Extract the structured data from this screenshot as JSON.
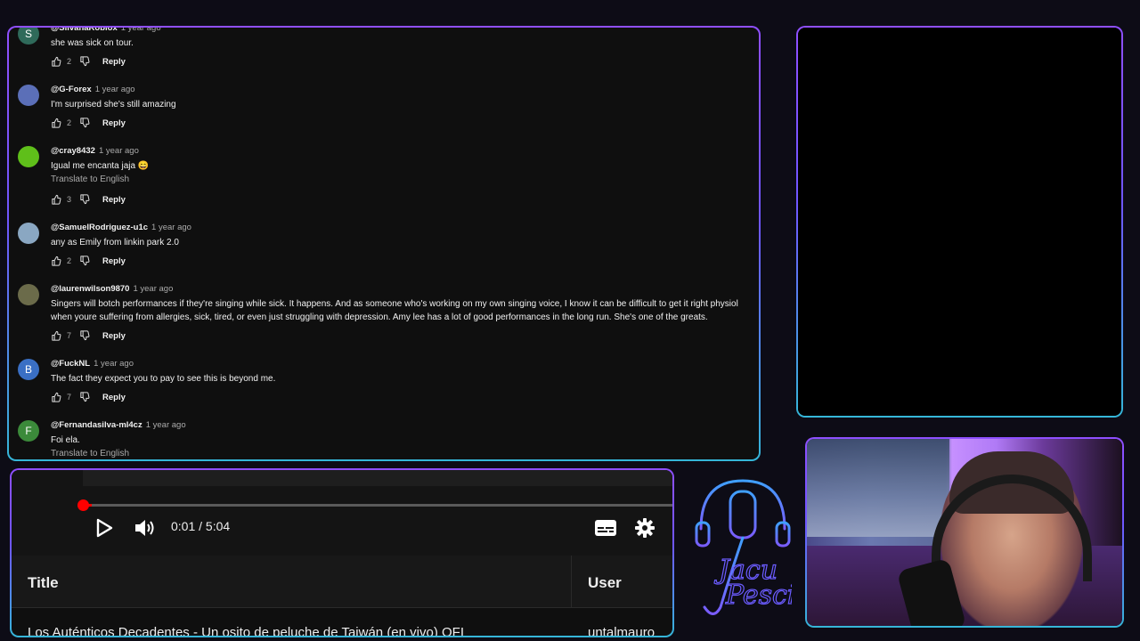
{
  "comments": [
    {
      "author": "@SilvanaRoblox",
      "time": "1 year ago",
      "text": "she was sick on tour.",
      "likes": "2",
      "avatar_letter": "S",
      "avatar_color": "#2f6a5a",
      "translate": null
    },
    {
      "author": "@G-Forex",
      "time": "1 year ago",
      "text": "I'm surprised she's still amazing",
      "likes": "2",
      "avatar_letter": "",
      "avatar_color": "#5b6fb8",
      "translate": null
    },
    {
      "author": "@cray8432",
      "time": "1 year ago",
      "text": "Igual me encanta jaja 😄",
      "likes": "3",
      "avatar_letter": "",
      "avatar_color": "#5fbf1a",
      "translate": "Translate to English"
    },
    {
      "author": "@SamuelRodriguez-u1c",
      "time": "1 year ago",
      "text": "any as Emily from linkin park 2.0",
      "likes": "2",
      "avatar_letter": "",
      "avatar_color": "#8aa7c2",
      "translate": null
    },
    {
      "author": "@laurenwilson9870",
      "time": "1 year ago",
      "text": "Singers will botch performances if they're singing while sick. It happens. And as someone who's working on my own singing voice, I know it can be difficult to get it right physiol",
      "text2": "when youre suffering from allergies, sick, tired, or even just struggling with depression. Amy lee has a lot of good performances in the long run. She's one of the greats.",
      "likes": "7",
      "avatar_letter": "",
      "avatar_color": "#6b6b4a",
      "translate": null
    },
    {
      "author": "@FuckNL",
      "time": "1 year ago",
      "text": "The fact they expect you to pay to see this is beyond me.",
      "likes": "7",
      "avatar_letter": "B",
      "avatar_color": "#3a6fc4",
      "translate": null
    },
    {
      "author": "@Fernandasilva-ml4cz",
      "time": "1 year ago",
      "text": "Foi ela.",
      "likes": "",
      "avatar_letter": "F",
      "avatar_color": "#3b8a3a",
      "translate": "Translate to English"
    }
  ],
  "reply_label": "Reply",
  "player": {
    "time": "0:01 / 5:04",
    "progress_fraction": 0.003
  },
  "table": {
    "col_title": "Title",
    "col_user": "User",
    "row_title": "Los Auténticos Decadentes - Un osito de peluche de Taiwán (en vivo) OFI",
    "row_user": "untalmauro"
  },
  "logo": {
    "line1": "Jacu",
    "line2": "Pesci"
  },
  "icons": {
    "like": "thumbs-up-icon",
    "dislike": "thumbs-down-icon",
    "play": "play-icon",
    "volume": "volume-icon",
    "captions": "captions-icon",
    "settings": "gear-icon",
    "logo": "headphones-microphone-logo"
  },
  "colors": {
    "accent_purple": "#8f4fff",
    "accent_cyan": "#35b6d8",
    "progress_red": "#ff0000"
  }
}
